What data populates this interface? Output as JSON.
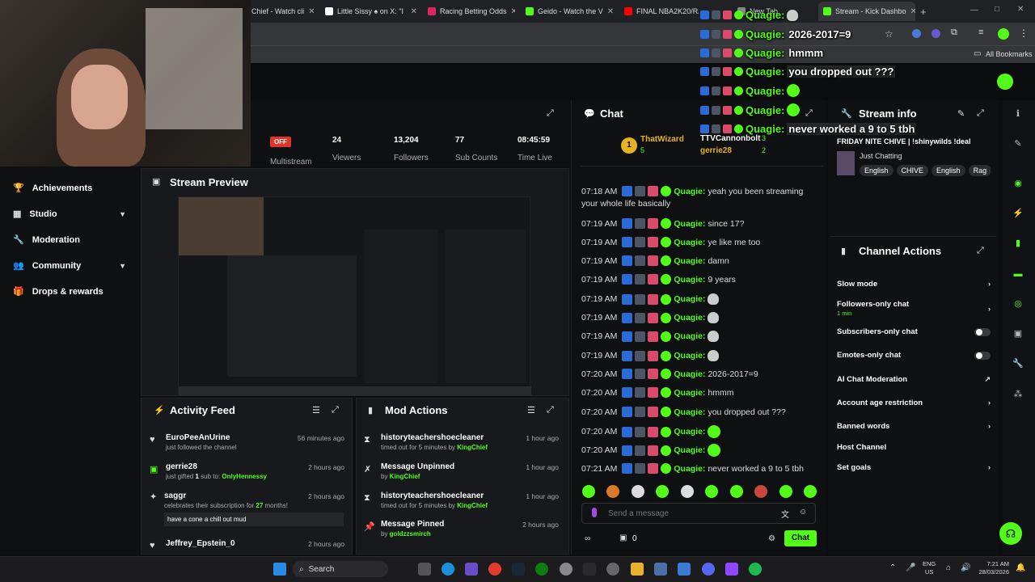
{
  "browser": {
    "tabs": [
      {
        "label": "Chief - Watch cli",
        "color": "#53fc18"
      },
      {
        "label": "Little Sissy ♠ on X: \"I",
        "color": "#ffffff"
      },
      {
        "label": "Racing Betting Odds",
        "color": "#e0245e"
      },
      {
        "label": "Geido - Watch the V",
        "color": "#53fc18"
      },
      {
        "label": "FINAL NBA2K20/RAC",
        "color": "#ff0000"
      },
      {
        "label": "New Tab",
        "color": "#888888"
      },
      {
        "label": "Stream - Kick Dashbo",
        "color": "#53fc18"
      }
    ],
    "bookmarks_label": "All Bookmarks"
  },
  "stats": {
    "status": "OFF",
    "multistream": "Multistream",
    "viewers": {
      "value": "24",
      "label": "Viewers"
    },
    "followers": {
      "value": "13,204",
      "label": "Followers"
    },
    "subs": {
      "value": "77",
      "label": "Sub Counts"
    },
    "time": {
      "value": "08:45:59",
      "label": "Time Live"
    }
  },
  "sidebar": {
    "items": [
      {
        "label": "Achievements"
      },
      {
        "label": "Studio"
      },
      {
        "label": "Moderation"
      },
      {
        "label": "Community"
      },
      {
        "label": "Drops & rewards"
      }
    ]
  },
  "preview": {
    "title": "Stream Preview"
  },
  "activity": {
    "title": "Activity Feed",
    "items": [
      {
        "name": "EuroPeeAnUrine",
        "sub": "just followed the channel",
        "time": "56 minutes ago"
      },
      {
        "name": "gerrie28",
        "sub_pre": "just gifted ",
        "sub_num": "1",
        "sub_mid": " sub to: ",
        "sub_user": "OnlyHennessy",
        "time": "2 hours ago"
      },
      {
        "name": "saggr",
        "sub_pre": "celebrates their subscription for ",
        "sub_num": "27",
        "sub_post": " months!",
        "message": "have a cone a chill out mud",
        "time": "2 hours ago"
      },
      {
        "name": "Jeffrey_Epstein_0",
        "time": "2 hours ago"
      }
    ]
  },
  "mod": {
    "title": "Mod Actions",
    "items": [
      {
        "name": "historyteachershoecleaner",
        "sub": "timed out for 5 minutes by ",
        "by": "KingChief",
        "time": "1 hour ago"
      },
      {
        "name": "Message Unpinned",
        "sub": "by ",
        "by": "KingChief",
        "time": "1 hour ago"
      },
      {
        "name": "historyteachershoecleaner",
        "sub": "timed out for 5 minutes by ",
        "by": "KingChief",
        "time": "1 hour ago"
      },
      {
        "name": "Message Pinned",
        "sub": "by ",
        "by": "goldzzsmirch",
        "time": "2 hours ago"
      }
    ]
  },
  "chat": {
    "title": "Chat",
    "gifters": [
      {
        "rank": "1",
        "name": "ThatWizard",
        "count": "5"
      },
      {
        "name": "TTVCannonbolt",
        "count": "3"
      },
      {
        "name": "gerrie28",
        "count": "2"
      }
    ],
    "messages": [
      {
        "time": "07:18 AM",
        "user": "Quagie:",
        "text": "yeah you been streaming"
      },
      {
        "time": "",
        "user": "",
        "text": "your whole life basically"
      },
      {
        "time": "07:19 AM",
        "user": "Quagie:",
        "text": "since 17?"
      },
      {
        "time": "07:19 AM",
        "user": "Quagie:",
        "text": "ye like me too"
      },
      {
        "time": "07:19 AM",
        "user": "Quagie:",
        "text": "damn"
      },
      {
        "time": "07:19 AM",
        "user": "Quagie:",
        "text": "9 years"
      },
      {
        "time": "07:19 AM",
        "user": "Quagie:",
        "text": ""
      },
      {
        "time": "07:19 AM",
        "user": "Quagie:",
        "text": ""
      },
      {
        "time": "07:19 AM",
        "user": "Quagie:",
        "text": ""
      },
      {
        "time": "07:19 AM",
        "user": "Quagie:",
        "text": ""
      },
      {
        "time": "07:20 AM",
        "user": "Quagie:",
        "text": "2026-2017=9"
      },
      {
        "time": "07:20 AM",
        "user": "Quagie:",
        "text": "hmmm"
      },
      {
        "time": "07:20 AM",
        "user": "Quagie:",
        "text": "you dropped out ???"
      },
      {
        "time": "07:20 AM",
        "user": "Quagie:",
        "text": ""
      },
      {
        "time": "07:20 AM",
        "user": "Quagie:",
        "text": ""
      },
      {
        "time": "07:21 AM",
        "user": "Quagie:",
        "text": "never worked a 9 to 5 tbh"
      }
    ],
    "placeholder": "Send a message",
    "points": "0",
    "send_label": "Chat"
  },
  "overlay": {
    "messages": [
      {
        "user": "Quagie:",
        "text": ""
      },
      {
        "user": "Quagie:",
        "text": "2026-2017=9"
      },
      {
        "user": "Quagie:",
        "text": "hmmm"
      },
      {
        "user": "Quagie:",
        "text": "you dropped out ???"
      },
      {
        "user": "Quagie:",
        "text": ""
      },
      {
        "user": "Quagie:",
        "text": ""
      },
      {
        "user": "Quagie:",
        "text": "never worked a 9 to 5 tbh"
      }
    ]
  },
  "streaminfo": {
    "title": "Stream info",
    "stream_title": "FRIDAY NITE CHIVE | !shinywilds !deal",
    "category": "Just Chatting",
    "tags": [
      "English",
      "CHIVE",
      "English",
      "Rag"
    ]
  },
  "actions": {
    "title": "Channel Actions",
    "items": [
      {
        "label": "Slow mode",
        "kind": "arrow"
      },
      {
        "label": "Followers-only chat",
        "sub": "1 min",
        "kind": "arrow"
      },
      {
        "label": "Subscribers-only chat",
        "kind": "toggle"
      },
      {
        "label": "Emotes-only chat",
        "kind": "toggle"
      },
      {
        "label": "AI Chat Moderation",
        "kind": "link"
      },
      {
        "label": "Account age restriction",
        "kind": "arrow"
      },
      {
        "label": "Banned words",
        "kind": "arrow"
      },
      {
        "label": "Host Channel",
        "kind": "none"
      },
      {
        "label": "Set goals",
        "kind": "arrow"
      }
    ]
  },
  "taskbar": {
    "search": "Search",
    "lang": "ENG",
    "region": "US",
    "time": "7:21 AM",
    "date": "28/03/2026"
  },
  "colors": {
    "accent": "#53fc18",
    "panel": "#18191c",
    "bg": "#0d0e10"
  }
}
